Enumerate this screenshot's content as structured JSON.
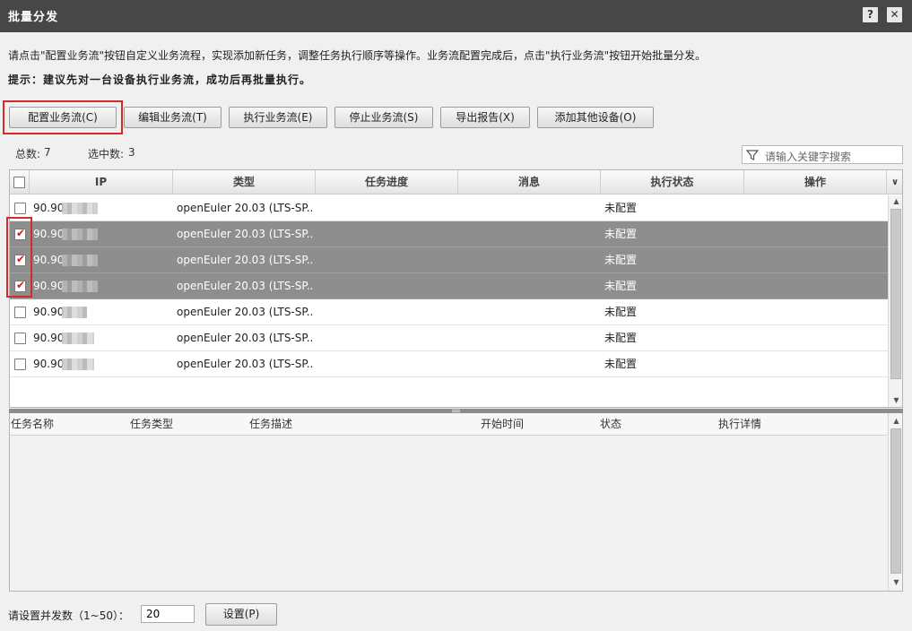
{
  "window": {
    "title": "批量分发",
    "help_label": "?",
    "close_label": "✕"
  },
  "intro_text": "请点击\"配置业务流\"按钮自定义业务流程，实现添加新任务，调整任务执行顺序等操作。业务流配置完成后，点击\"执行业务流\"按钮开始批量分发。",
  "hint_text": "提示：建议先对一台设备执行业务流，成功后再批量执行。",
  "toolbar": {
    "configure": "配置业务流(C)",
    "edit": "编辑业务流(T)",
    "execute": "执行业务流(E)",
    "stop": "停止业务流(S)",
    "export": "导出报告(X)",
    "add_device": "添加其他设备(O)"
  },
  "stats": {
    "total_label": "总数:",
    "total": "7",
    "selected_label": "选中数:",
    "selected": "3"
  },
  "search": {
    "placeholder": "请输入关键字搜索"
  },
  "device_table": {
    "columns": [
      "IP",
      "类型",
      "任务进度",
      "消息",
      "执行状态",
      "操作"
    ],
    "rows": [
      {
        "ip": "90.90",
        "type": "openEuler 20.03 (LTS-SP...",
        "status": "未配置",
        "checked": false
      },
      {
        "ip": "90.90",
        "type": "openEuler 20.03 (LTS-SP...",
        "status": "未配置",
        "checked": true
      },
      {
        "ip": "90.90",
        "type": "openEuler 20.03 (LTS-SP...",
        "status": "未配置",
        "checked": true
      },
      {
        "ip": "90.90",
        "type": "openEuler 20.03 (LTS-SP...",
        "status": "未配置",
        "checked": true
      },
      {
        "ip": "90.90",
        "type": "openEuler 20.03 (LTS-SP...",
        "status": "未配置",
        "checked": false
      },
      {
        "ip": "90.90",
        "type": "openEuler 20.03 (LTS-SP...",
        "status": "未配置",
        "checked": false
      },
      {
        "ip": "90.90",
        "type": "openEuler 20.03 (LTS-SP...",
        "status": "未配置",
        "checked": false
      }
    ]
  },
  "task_table": {
    "columns": [
      "任务名称",
      "任务类型",
      "任务描述",
      "开始时间",
      "状态",
      "执行详情"
    ]
  },
  "footer": {
    "concurrency_label": "请设置并发数（1~50）：",
    "concurrency_value": "20",
    "set_button": "设置(P)"
  },
  "colors": {
    "titlebar": "#474747",
    "selected_row": "#8e8e8e",
    "highlight": "#d42a2a"
  }
}
